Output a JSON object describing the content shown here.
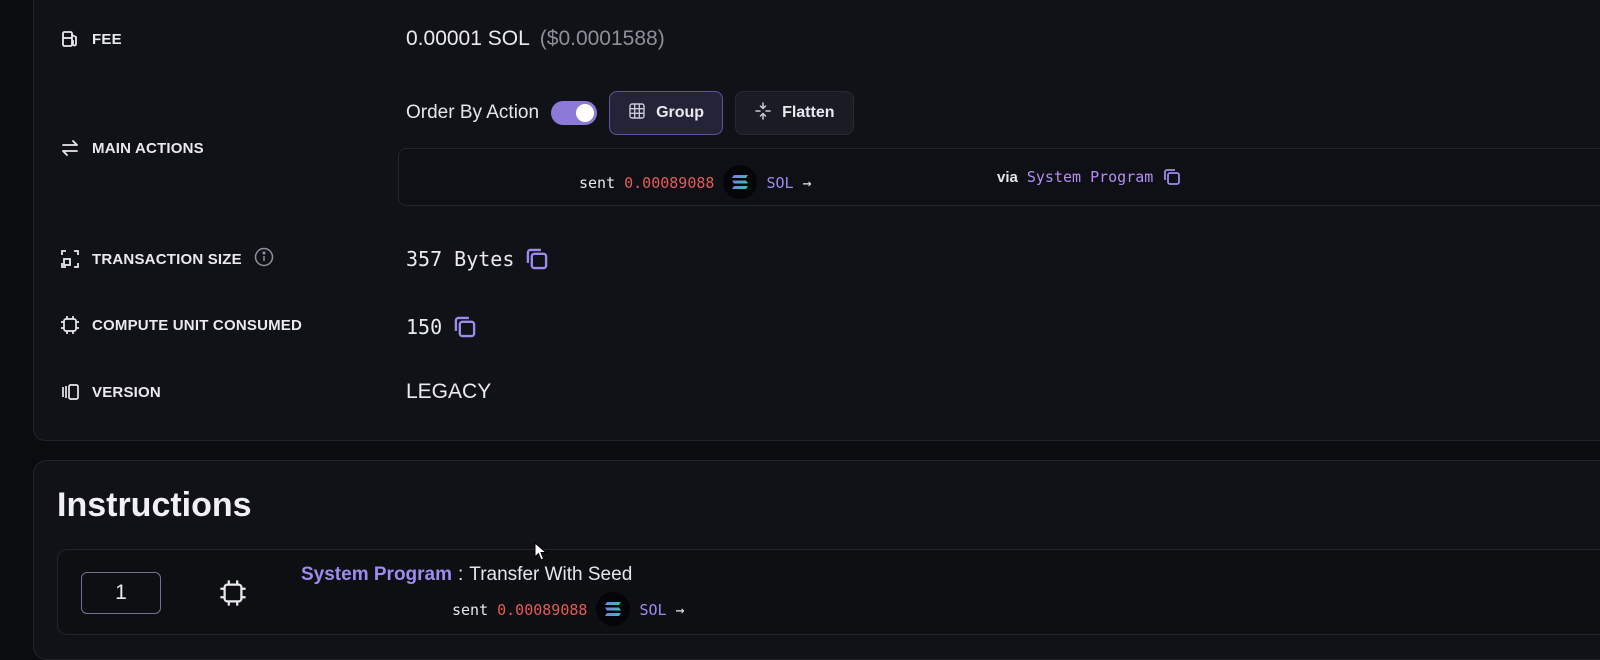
{
  "details": {
    "fee": {
      "label": "FEE",
      "amount": "0.00001 SOL",
      "usd": "($0.0001588)"
    },
    "main_actions": {
      "label": "MAIN ACTIONS",
      "order_by_label": "Order By Action",
      "order_by_enabled": true,
      "group_label": "Group",
      "flatten_label": "Flatten",
      "action": {
        "verb": "sent",
        "amount": "0.00089088",
        "token": "SOL",
        "arrow": "→",
        "via_label": "via",
        "program": "System Program"
      }
    },
    "transaction_size": {
      "label": "TRANSACTION SIZE",
      "value": "357 Bytes"
    },
    "compute_units": {
      "label": "COMPUTE UNIT CONSUMED",
      "value": "150"
    },
    "version": {
      "label": "VERSION",
      "value": "LEGACY"
    }
  },
  "instructions": {
    "title": "Instructions",
    "items": [
      {
        "index": "1",
        "program": "System Program",
        "separator": ":",
        "name": "Transfer With Seed",
        "action": {
          "verb": "sent",
          "amount": "0.00089088",
          "token": "SOL",
          "arrow": "→"
        }
      }
    ]
  },
  "colors": {
    "accent": "#9d8cf0",
    "amount_red": "#e05c57",
    "background": "#0b0c10",
    "card": "#111217"
  }
}
